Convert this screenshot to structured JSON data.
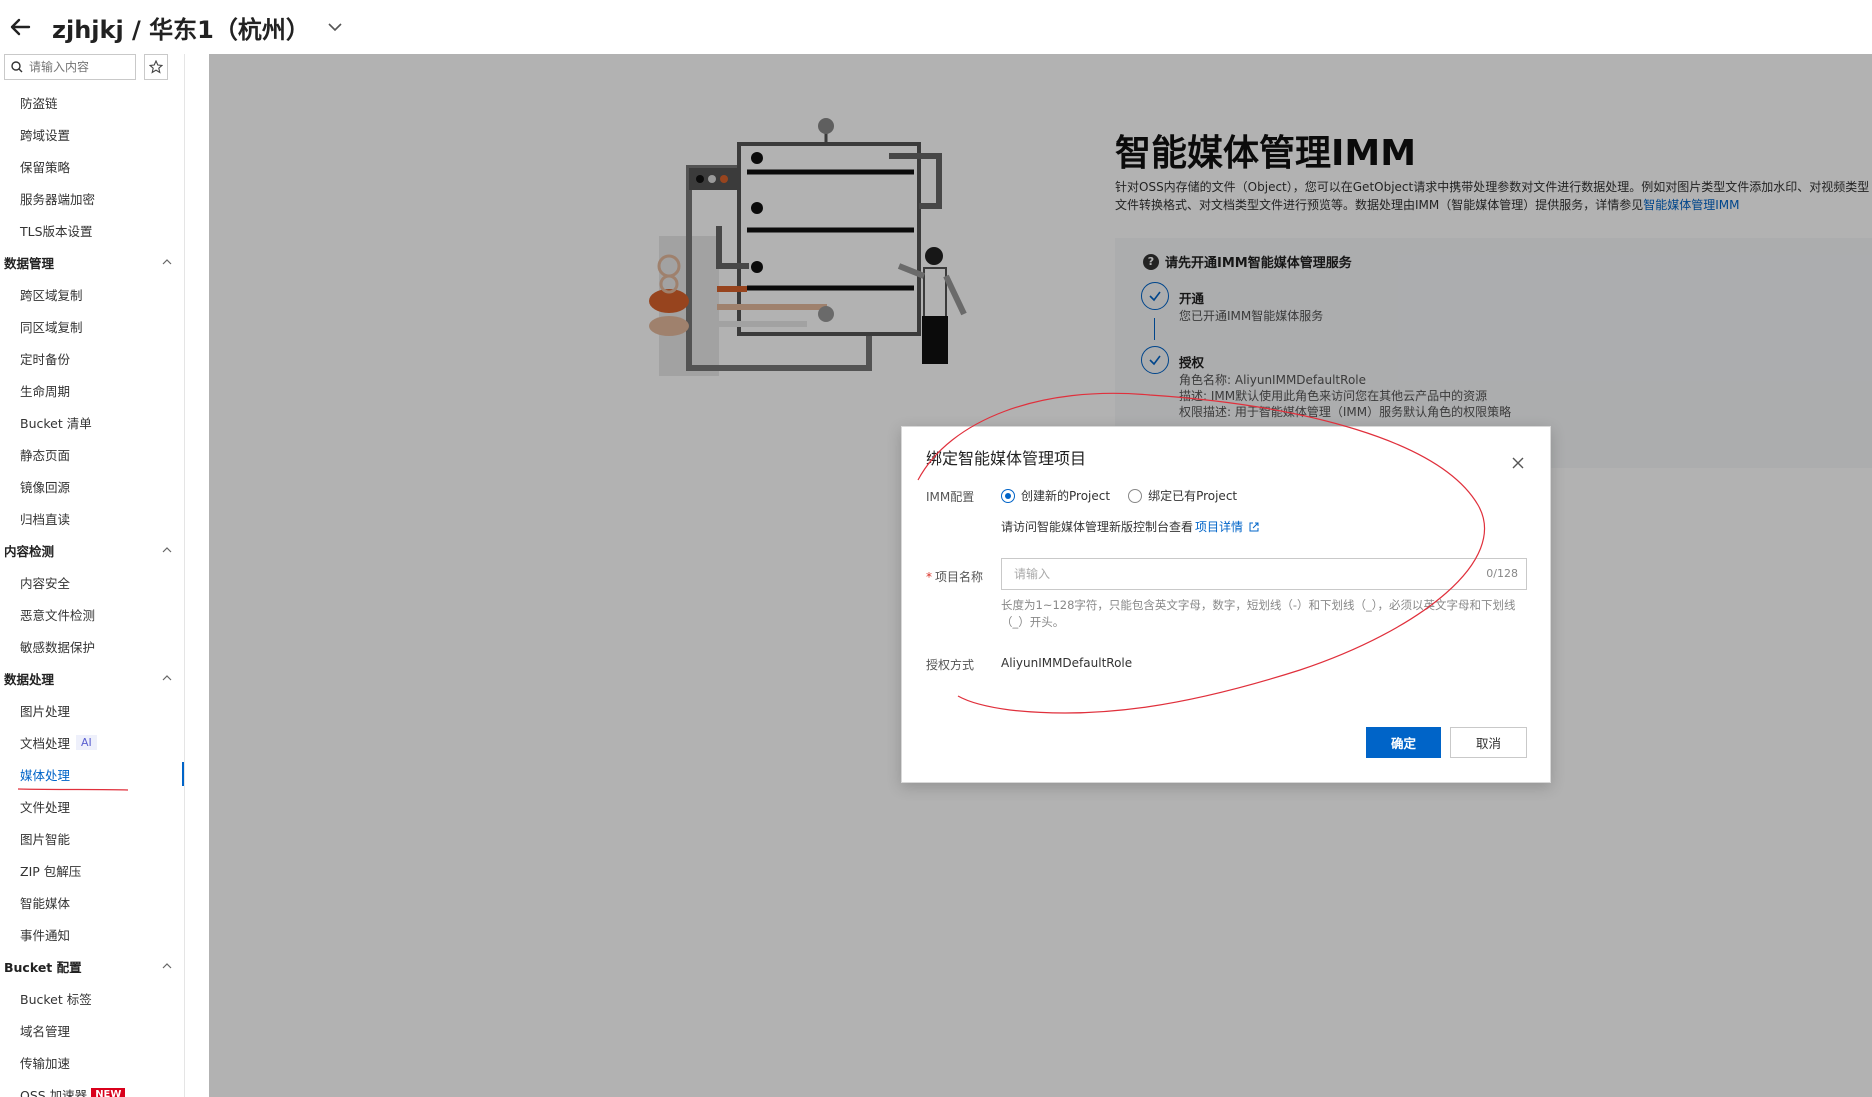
{
  "header": {
    "title": "zjhjkj / 华东1（杭州）"
  },
  "sidebar": {
    "search_placeholder": "请输入内容",
    "rows": [
      {
        "kind": "item",
        "label": "防盗链"
      },
      {
        "kind": "item",
        "label": "跨域设置"
      },
      {
        "kind": "item",
        "label": "保留策略"
      },
      {
        "kind": "item",
        "label": "服务器端加密"
      },
      {
        "kind": "item",
        "label": "TLS版本设置"
      },
      {
        "kind": "group",
        "label": "数据管理"
      },
      {
        "kind": "item",
        "label": "跨区域复制"
      },
      {
        "kind": "item",
        "label": "同区域复制"
      },
      {
        "kind": "item",
        "label": "定时备份"
      },
      {
        "kind": "item",
        "label": "生命周期"
      },
      {
        "kind": "item",
        "label": "Bucket 清单"
      },
      {
        "kind": "item",
        "label": "静态页面"
      },
      {
        "kind": "item",
        "label": "镜像回源"
      },
      {
        "kind": "item",
        "label": "归档直读"
      },
      {
        "kind": "group",
        "label": "内容检测"
      },
      {
        "kind": "item",
        "label": "内容安全"
      },
      {
        "kind": "item",
        "label": "恶意文件检测"
      },
      {
        "kind": "item",
        "label": "敏感数据保护"
      },
      {
        "kind": "group",
        "label": "数据处理"
      },
      {
        "kind": "item",
        "label": "图片处理"
      },
      {
        "kind": "item",
        "label": "文档处理",
        "badge": "AI"
      },
      {
        "kind": "item",
        "label": "媒体处理",
        "active": true
      },
      {
        "kind": "item",
        "label": "文件处理"
      },
      {
        "kind": "item",
        "label": "图片智能"
      },
      {
        "kind": "item",
        "label": "ZIP 包解压"
      },
      {
        "kind": "item",
        "label": "智能媒体"
      },
      {
        "kind": "item",
        "label": "事件通知"
      },
      {
        "kind": "group",
        "label": "Bucket 配置"
      },
      {
        "kind": "item",
        "label": "Bucket 标签"
      },
      {
        "kind": "item",
        "label": "域名管理"
      },
      {
        "kind": "item",
        "label": "传输加速"
      },
      {
        "kind": "item",
        "label": "OSS 加速器",
        "badge_new": "NEW"
      }
    ]
  },
  "main": {
    "title": "智能媒体管理IMM",
    "desc_prefix": "针对OSS内存储的文件（Object），您可以在GetObject请求中携带处理参数对文件进行数据处理。例如对图片类型文件添加水印、对视频类型文件转换格式、对文档类型文件进行预览等。数据处理由IMM（智能媒体管理）提供服务，详情参见",
    "desc_link": "智能媒体管理IMM",
    "steps_heading": "请先开通IMM智能媒体管理服务",
    "step1_title": "开通",
    "step1_text": "您已开通IMM智能媒体服务",
    "step2_title": "授权",
    "step2_line1": "角色名称: AliyunIMMDefaultRole",
    "step2_line2": "描述: IMM默认使用此角色来访问您在其他云产品中的资源",
    "step2_line3": "权限描述: 用于智能媒体管理（IMM）服务默认角色的权限策略"
  },
  "modal": {
    "title": "绑定智能媒体管理项目",
    "imm_config_label": "IMM配置",
    "radio_new": "创建新的Project",
    "radio_existing": "绑定已有Project",
    "hint_text": "请访问智能媒体管理新版控制台查看",
    "hint_link": "项目详情",
    "project_name_label": "项目名称",
    "required_mark": "*",
    "project_name_placeholder": "请输入",
    "project_name_value": "",
    "counter": "0/128",
    "input_help": "长度为1~128字符，只能包含英文字母，数字，短划线（-）和下划线（_），必须以英文字母和下划线（_）开头。",
    "auth_label": "授权方式",
    "auth_value": "AliyunIMMDefaultRole",
    "ok_label": "确定",
    "cancel_label": "取消"
  },
  "colors": {
    "primary": "#0064c8",
    "annotation": "#e0303c",
    "overlay": "rgba(0,0,0,0.30)",
    "new_badge": "#d9001b"
  },
  "icons": [
    "back-arrow-icon",
    "chevron-down-icon",
    "search-icon",
    "star-icon",
    "chevron-up-icon",
    "question-icon",
    "check-icon",
    "close-icon",
    "external-link-icon"
  ]
}
